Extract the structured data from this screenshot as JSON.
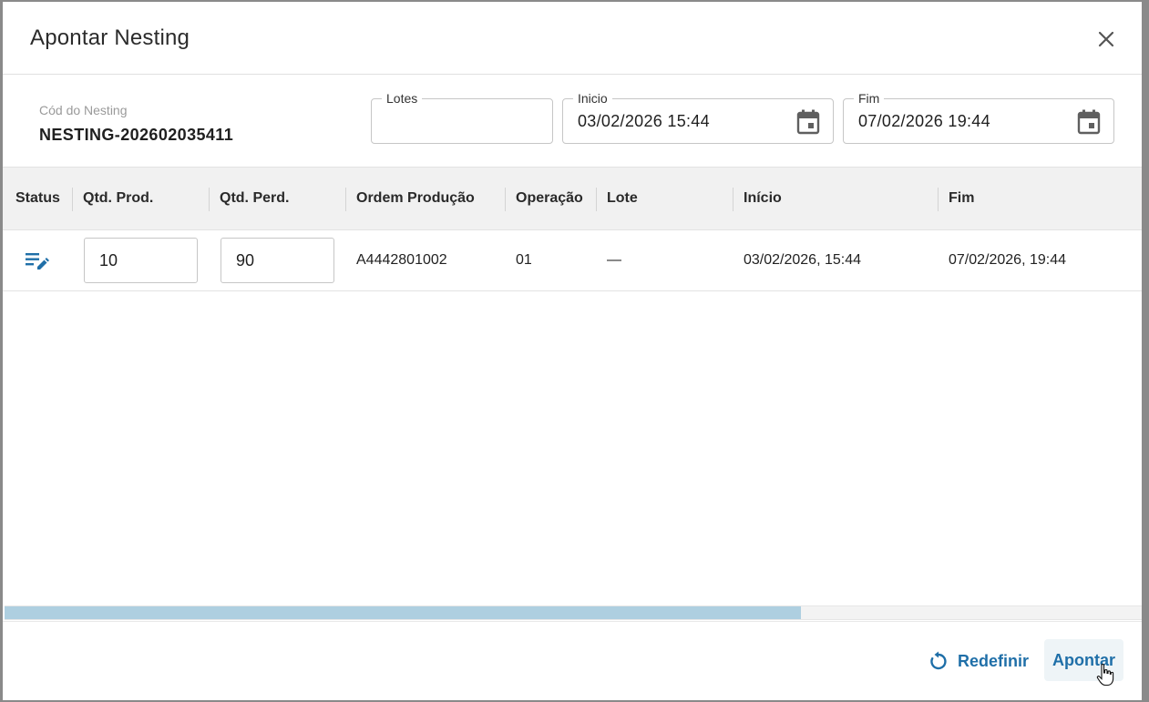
{
  "dialog": {
    "title": "Apontar Nesting"
  },
  "info": {
    "code_label": "Cód do Nesting",
    "code_value": "NESTING-202602035411"
  },
  "fields": {
    "lotes": {
      "label": "Lotes",
      "value": ""
    },
    "inicio": {
      "label": "Inicio",
      "value": "03/02/2026 15:44"
    },
    "fim": {
      "label": "Fim",
      "value": "07/02/2026 19:44"
    }
  },
  "grid": {
    "columns": [
      {
        "label": "Status"
      },
      {
        "label": "Qtd. Prod."
      },
      {
        "label": "Qtd. Perd."
      },
      {
        "label": "Ordem Produção"
      },
      {
        "label": "Operação"
      },
      {
        "label": "Lote"
      },
      {
        "label": "Início"
      },
      {
        "label": "Fim"
      }
    ],
    "rows": [
      {
        "status_icon": "edit-note-icon",
        "qtd_prod": "10",
        "qtd_perd": "90",
        "ordem": "A4442801002",
        "operacao": "01",
        "lote": "—",
        "inicio": "03/02/2026, 15:44",
        "fim": "07/02/2026, 19:44"
      }
    ],
    "scroll_fraction": 0.7
  },
  "footer": {
    "reset_label": "Redefinir",
    "submit_label": "Apontar"
  },
  "colors": {
    "accent": "#1f6fa8",
    "scroll_thumb": "#aecfe0",
    "header_bg": "#f1f1f1"
  }
}
